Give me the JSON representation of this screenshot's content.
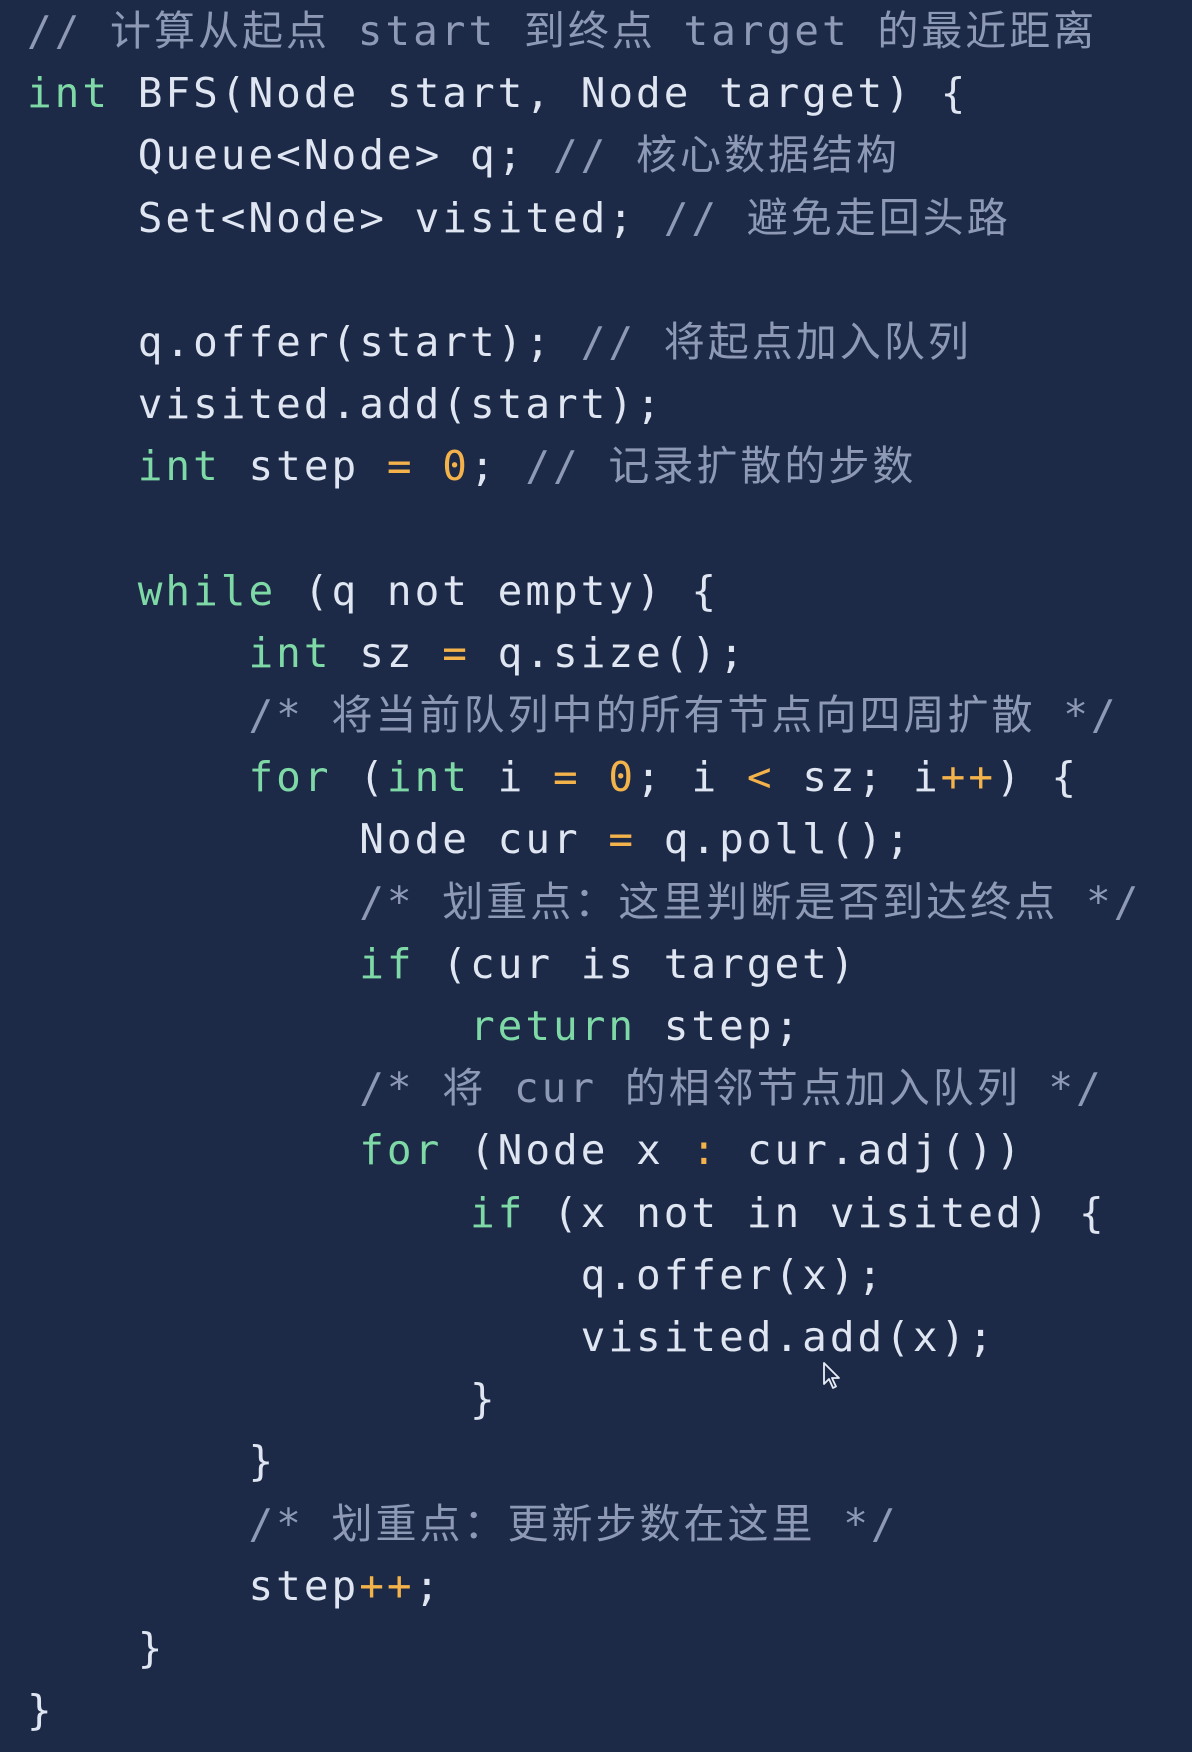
{
  "editor": {
    "theme": {
      "background": "#1c2a48",
      "keyword": "#7ed9a6",
      "number": "#f3b24a",
      "operator": "#f3b24a",
      "comment": "#8d99b5",
      "text": "#dfe6f2"
    },
    "lines": [
      [
        {
          "t": "cm",
          "v": "// 计算从起点 start 到终点 target 的最近距离"
        }
      ],
      [
        {
          "t": "kw",
          "v": "int"
        },
        {
          "t": "id",
          "v": " BFS(Node start, Node target) {"
        }
      ],
      [
        {
          "t": "id",
          "v": "    Queue<Node> q; "
        },
        {
          "t": "cm",
          "v": "// 核心数据结构"
        }
      ],
      [
        {
          "t": "id",
          "v": "    Set<Node> visited; "
        },
        {
          "t": "cm",
          "v": "// 避免走回头路"
        }
      ],
      [],
      [
        {
          "t": "id",
          "v": "    q.offer(start); "
        },
        {
          "t": "cm",
          "v": "// 将起点加入队列"
        }
      ],
      [
        {
          "t": "id",
          "v": "    visited.add(start);"
        }
      ],
      [
        {
          "t": "id",
          "v": "    "
        },
        {
          "t": "kw",
          "v": "int"
        },
        {
          "t": "id",
          "v": " step "
        },
        {
          "t": "op",
          "v": "="
        },
        {
          "t": "id",
          "v": " "
        },
        {
          "t": "num",
          "v": "0"
        },
        {
          "t": "id",
          "v": "; "
        },
        {
          "t": "cm",
          "v": "// 记录扩散的步数"
        }
      ],
      [],
      [
        {
          "t": "id",
          "v": "    "
        },
        {
          "t": "kw",
          "v": "while"
        },
        {
          "t": "id",
          "v": " (q not empty) {"
        }
      ],
      [
        {
          "t": "id",
          "v": "        "
        },
        {
          "t": "kw",
          "v": "int"
        },
        {
          "t": "id",
          "v": " sz "
        },
        {
          "t": "op",
          "v": "="
        },
        {
          "t": "id",
          "v": " q.size();"
        }
      ],
      [
        {
          "t": "id",
          "v": "        "
        },
        {
          "t": "cm",
          "v": "/* 将当前队列中的所有节点向四周扩散 */"
        }
      ],
      [
        {
          "t": "id",
          "v": "        "
        },
        {
          "t": "kw",
          "v": "for"
        },
        {
          "t": "id",
          "v": " ("
        },
        {
          "t": "kw",
          "v": "int"
        },
        {
          "t": "id",
          "v": " i "
        },
        {
          "t": "op",
          "v": "="
        },
        {
          "t": "id",
          "v": " "
        },
        {
          "t": "num",
          "v": "0"
        },
        {
          "t": "id",
          "v": "; i "
        },
        {
          "t": "op",
          "v": "<"
        },
        {
          "t": "id",
          "v": " sz; i"
        },
        {
          "t": "op",
          "v": "++"
        },
        {
          "t": "id",
          "v": ") {"
        }
      ],
      [
        {
          "t": "id",
          "v": "            Node cur "
        },
        {
          "t": "op",
          "v": "="
        },
        {
          "t": "id",
          "v": " q.poll();"
        }
      ],
      [
        {
          "t": "id",
          "v": "            "
        },
        {
          "t": "cm",
          "v": "/* 划重点：这里判断是否到达终点 */"
        }
      ],
      [
        {
          "t": "id",
          "v": "            "
        },
        {
          "t": "kw",
          "v": "if"
        },
        {
          "t": "id",
          "v": " (cur is target)"
        }
      ],
      [
        {
          "t": "id",
          "v": "                "
        },
        {
          "t": "kw",
          "v": "return"
        },
        {
          "t": "id",
          "v": " step;"
        }
      ],
      [
        {
          "t": "id",
          "v": "            "
        },
        {
          "t": "cm",
          "v": "/* 将 cur 的相邻节点加入队列 */"
        }
      ],
      [
        {
          "t": "id",
          "v": "            "
        },
        {
          "t": "kw",
          "v": "for"
        },
        {
          "t": "id",
          "v": " (Node x "
        },
        {
          "t": "op",
          "v": ":"
        },
        {
          "t": "id",
          "v": " cur.adj())"
        }
      ],
      [
        {
          "t": "id",
          "v": "                "
        },
        {
          "t": "kw",
          "v": "if"
        },
        {
          "t": "id",
          "v": " (x not in visited) {"
        }
      ],
      [
        {
          "t": "id",
          "v": "                    q.offer(x);"
        }
      ],
      [
        {
          "t": "id",
          "v": "                    visited.add(x);"
        }
      ],
      [
        {
          "t": "id",
          "v": "                }"
        }
      ],
      [
        {
          "t": "id",
          "v": "        }"
        }
      ],
      [
        {
          "t": "id",
          "v": "        "
        },
        {
          "t": "cm",
          "v": "/* 划重点：更新步数在这里 */"
        }
      ],
      [
        {
          "t": "id",
          "v": "        step"
        },
        {
          "t": "op",
          "v": "++"
        },
        {
          "t": "id",
          "v": ";"
        }
      ],
      [
        {
          "t": "id",
          "v": "    }"
        }
      ],
      [
        {
          "t": "id",
          "v": "}"
        }
      ]
    ]
  },
  "cursor": {
    "icon": "mouse-pointer-icon"
  }
}
